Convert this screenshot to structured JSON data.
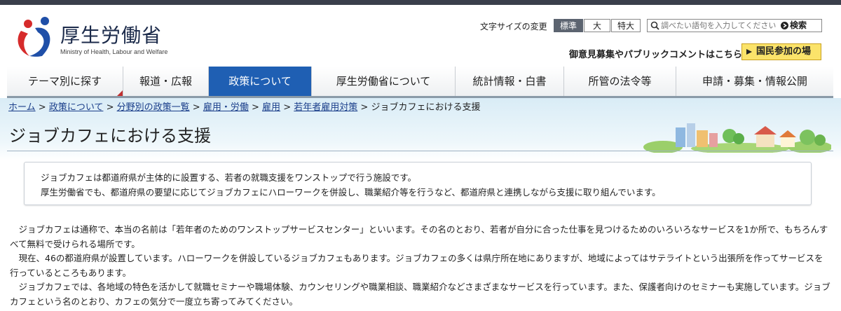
{
  "header": {
    "site_name": "厚生労働省",
    "site_subtitle": "Ministry of Health, Labour and Welfare",
    "font_size_label": "文字サイズの変更",
    "font_sizes": [
      "標準",
      "大",
      "特大"
    ],
    "search_placeholder": "調べたい語句を入力してください",
    "search_button": "検索",
    "opinion_link": "御意見募集やパブリックコメントはこちら",
    "participate_button": "国民参加の場"
  },
  "nav": {
    "items": [
      "テーマ別に探す",
      "報道・広報",
      "政策について",
      "厚生労働省について",
      "統計情報・白書",
      "所管の法令等",
      "申請・募集・情報公開"
    ],
    "active_index": 2
  },
  "breadcrumb": {
    "links": [
      "ホーム",
      "政策について",
      "分野別の政策一覧",
      "雇用・労働",
      "雇用",
      "若年者雇用対策"
    ],
    "separator": ">",
    "current": "ジョブカフェにおける支援"
  },
  "page_title": "ジョブカフェにおける支援",
  "intro": {
    "line1": "ジョブカフェは都道府県が主体的に設置する、若者の就職支援をワンストップで行う施設です。",
    "line2": "厚生労働省でも、都道府県の要望に応じてジョブカフェにハローワークを併設し、職業紹介等を行うなど、都道府県と連携しながら支援に取り組んでいます。"
  },
  "body": {
    "p1": "ジョブカフェは通称で、本当の名前は「若年者のためのワンストップサービスセンター」といいます。その名のとおり、若者が自分に合った仕事を見つけるためのいろいろなサービスを1か所で、もちろんすべて無料で受けられる場所です。",
    "p2": "現在、46の都道府県が設置しています。ハローワークを併設しているジョブカフェもあります。ジョブカフェの多くは県庁所在地にありますが、地域によってはサテライトという出張所を作ってサービスを行っているところもあります。",
    "p3": "ジョブカフェでは、各地域の特色を活かして就職セミナーや職場体験、カウンセリングや職業相談、職業紹介などさまざまなサービスを行っています。また、保護者向けのセミナーも実施しています。ジョブカフェという名のとおり、カフェの気分で一度立ち寄ってみてください。"
  },
  "colors": {
    "nav_active": "#1f5fb3",
    "participate_bg": "#fbe36a",
    "link": "#1a3e8a",
    "logo_red": "#d62b2b",
    "logo_blue": "#1f4fa8"
  }
}
